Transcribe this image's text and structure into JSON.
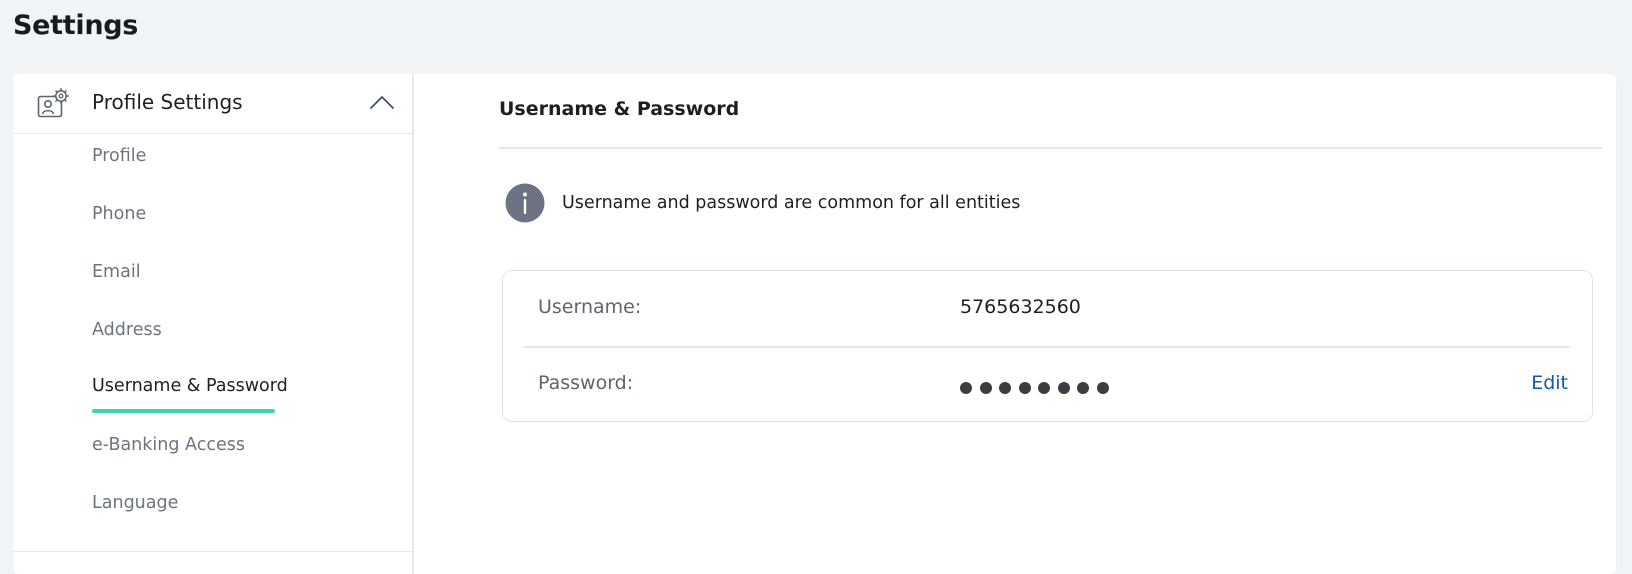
{
  "page": {
    "title": "Settings"
  },
  "sidebar": {
    "header": {
      "label": "Profile Settings",
      "icon": "profile-settings-icon",
      "expanded": true
    },
    "items": [
      {
        "label": "Profile",
        "active": false
      },
      {
        "label": "Phone",
        "active": false
      },
      {
        "label": "Email",
        "active": false
      },
      {
        "label": "Address",
        "active": false
      },
      {
        "label": "Username & Password",
        "active": true
      },
      {
        "label": "e-Banking Access",
        "active": false
      },
      {
        "label": "Language",
        "active": false
      }
    ],
    "active_accent_color": "#3dd6a6"
  },
  "main": {
    "section_title": "Username & Password",
    "info": {
      "icon": "info-icon",
      "text": "Username and password are common for all entities"
    },
    "credentials": {
      "username_label": "Username:",
      "username_value": "5765632560",
      "password_label": "Password:",
      "password_masked_length": 8,
      "edit_label": "Edit"
    },
    "link_color": "#1357b8"
  }
}
